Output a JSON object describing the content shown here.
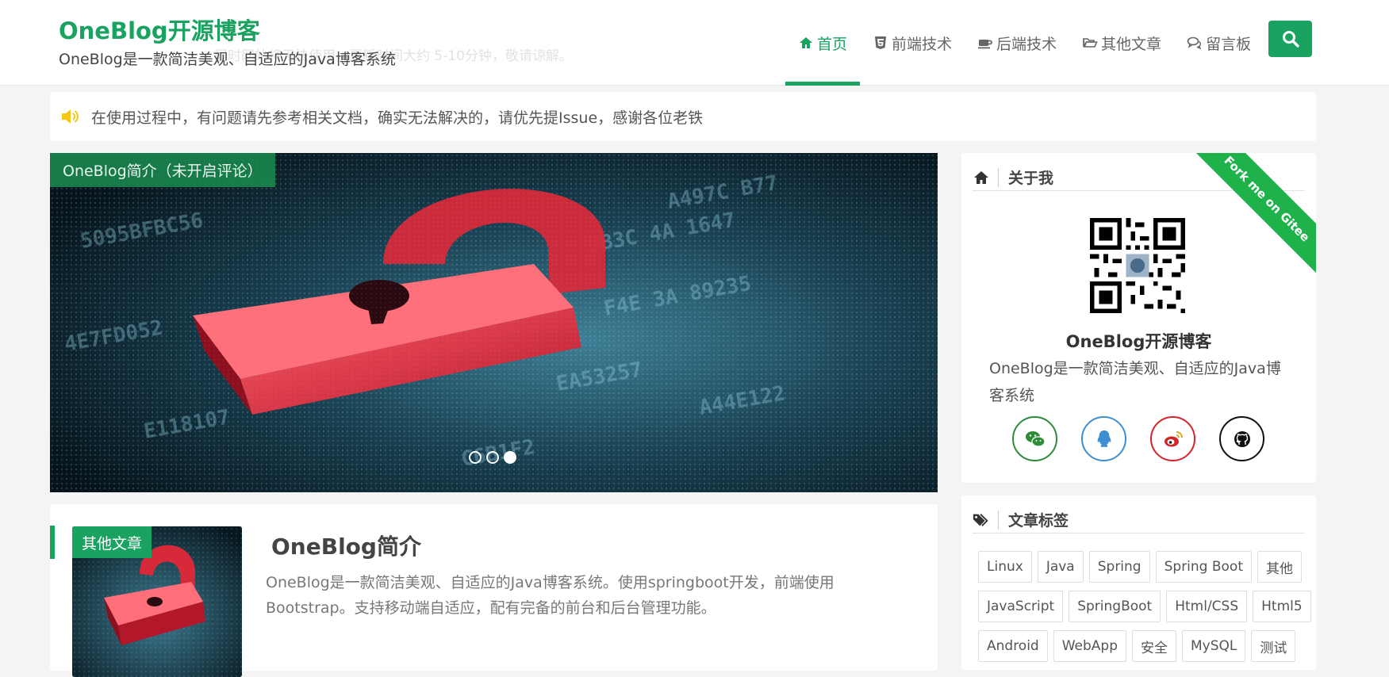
{
  "header": {
    "brand_title": "OneBlog开源博客",
    "brand_subtitle": "OneBlog是一款简洁美观、自适应的Java博客系统",
    "ghost_notice": "届时网站将无法使用，更新时间大约 5-10分钟，敬请谅解。",
    "nav": [
      {
        "label": "首页",
        "icon": "home-icon",
        "active": true
      },
      {
        "label": "前端技术",
        "icon": "html5-icon",
        "active": false
      },
      {
        "label": "后端技术",
        "icon": "coffee-icon",
        "active": false
      },
      {
        "label": "其他文章",
        "icon": "folder-open-icon",
        "active": false
      },
      {
        "label": "留言板",
        "icon": "comments-icon",
        "active": false
      }
    ],
    "search_icon": "search-icon"
  },
  "notice": {
    "icon": "speaker-icon",
    "text": "在使用过程中，有问题请先参考相关文档，确实无法解决的，请优先提Issue，感谢各位老铁"
  },
  "carousel": {
    "caption": "OneBlog简介（未开启评论）",
    "slide_count": 3,
    "active_index": 2
  },
  "article": {
    "category_badge": "其他文章",
    "title": "OneBlog简介",
    "summary": "OneBlog是一款简洁美观、自适应的Java博客系统。使用springboot开发，前端使用Bootstrap。支持移动端自适应，配有完备的前台和后台管理功能。"
  },
  "about": {
    "heading": "关于我",
    "ribbon": "Fork me on Gitee",
    "name": "OneBlog开源博客",
    "description": "OneBlog是一款简洁美观、自适应的Java博客系统",
    "socials": [
      {
        "icon": "wechat-icon",
        "color": "#2e8b3a"
      },
      {
        "icon": "qq-icon",
        "color": "#3d8fd1"
      },
      {
        "icon": "weibo-icon",
        "color": "#d0262b"
      },
      {
        "icon": "github-icon",
        "color": "#111111"
      }
    ]
  },
  "tags": {
    "heading": "文章标签",
    "items": [
      "Linux",
      "Java",
      "Spring",
      "Spring Boot",
      "其他",
      "JavaScript",
      "SpringBoot",
      "Html/CSS",
      "Html5",
      "Android",
      "WebApp",
      "安全",
      "MySQL",
      "测试"
    ]
  },
  "colors": {
    "accent": "#1aa260",
    "ribbon": "#1fb24a"
  }
}
